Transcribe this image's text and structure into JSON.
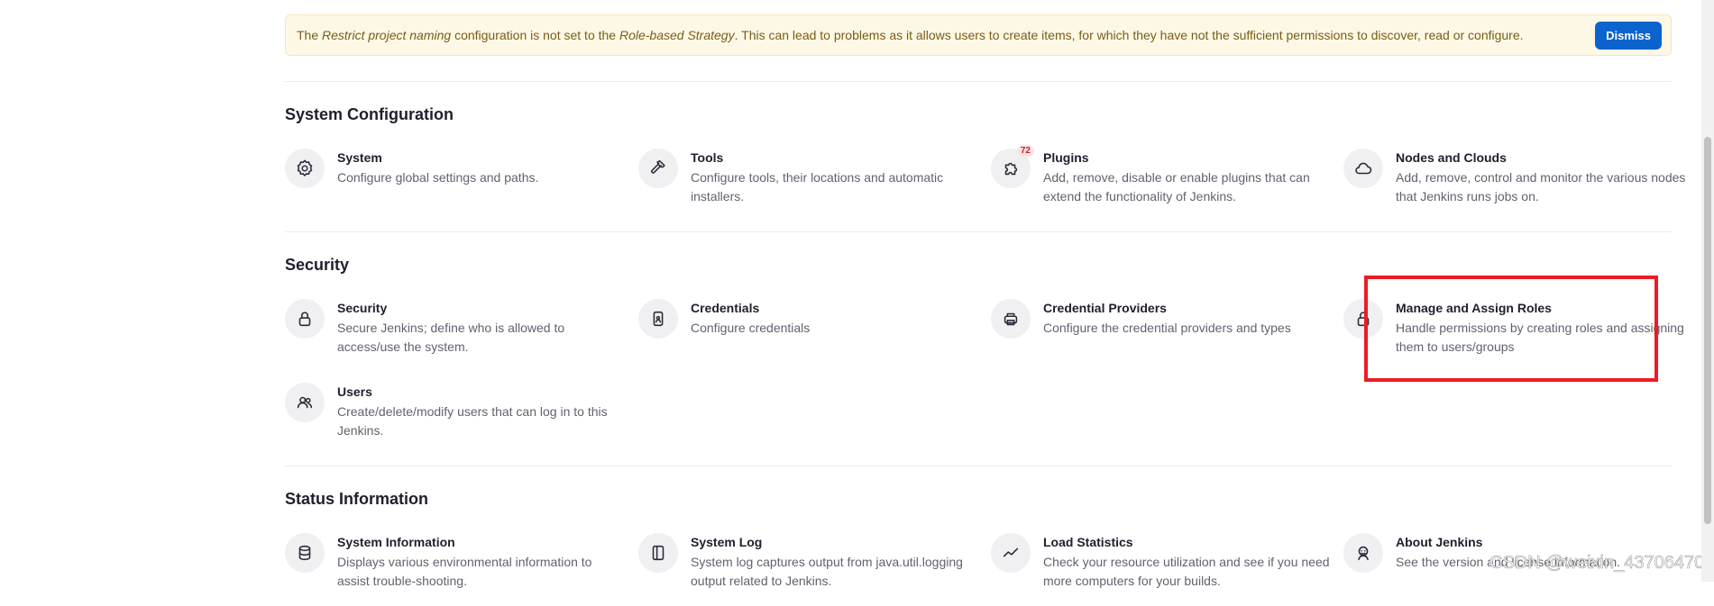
{
  "notice": {
    "part1": "The ",
    "em1": "Restrict project naming",
    "part2": " configuration is not set to the ",
    "em2": "Role-based Strategy",
    "part3": ". This can lead to problems as it allows users to create items, for which they have not the sufficient permissions to discover, read or configure.",
    "dismiss_label": "Dismiss"
  },
  "sections": {
    "system_configuration": {
      "title": "System Configuration",
      "items": [
        {
          "title": "System",
          "desc": "Configure global settings and paths.",
          "icon": "gear-icon"
        },
        {
          "title": "Tools",
          "desc": "Configure tools, their locations and automatic installers.",
          "icon": "hammer-icon"
        },
        {
          "title": "Plugins",
          "desc": "Add, remove, disable or enable plugins that can extend the functionality of Jenkins.",
          "icon": "puzzle-icon",
          "badge": "72"
        },
        {
          "title": "Nodes and Clouds",
          "desc": "Add, remove, control and monitor the various nodes that Jenkins runs jobs on.",
          "icon": "cloud-icon"
        }
      ]
    },
    "security": {
      "title": "Security",
      "items": [
        {
          "title": "Security",
          "desc": "Secure Jenkins; define who is allowed to access/use the system.",
          "icon": "lock-icon"
        },
        {
          "title": "Credentials",
          "desc": "Configure credentials",
          "icon": "credentials-icon"
        },
        {
          "title": "Credential Providers",
          "desc": "Configure the credential providers and types",
          "icon": "credential-providers-icon"
        },
        {
          "title": "Manage and Assign Roles",
          "desc": "Handle permissions by creating roles and assigning them to users/groups",
          "icon": "lock-icon"
        },
        {
          "title": "Users",
          "desc": "Create/delete/modify users that can log in to this Jenkins.",
          "icon": "users-icon"
        }
      ]
    },
    "status_information": {
      "title": "Status Information",
      "items": [
        {
          "title": "System Information",
          "desc": "Displays various environmental information to assist trouble-shooting.",
          "icon": "database-icon"
        },
        {
          "title": "System Log",
          "desc": "System log captures output from java.util.logging output related to Jenkins.",
          "icon": "log-icon"
        },
        {
          "title": "Load Statistics",
          "desc": "Check your resource utilization and see if you need more computers for your builds.",
          "icon": "chart-line-icon"
        },
        {
          "title": "About Jenkins",
          "desc": "See the version and license information.",
          "icon": "jenkins-icon"
        }
      ]
    }
  },
  "watermark": "CSDN @weixin_43706470",
  "colors": {
    "accent": "#0b63ce",
    "notice_bg": "#fdf8e6",
    "highlight": "#ec1c24",
    "badge_text": "#c4272b"
  }
}
